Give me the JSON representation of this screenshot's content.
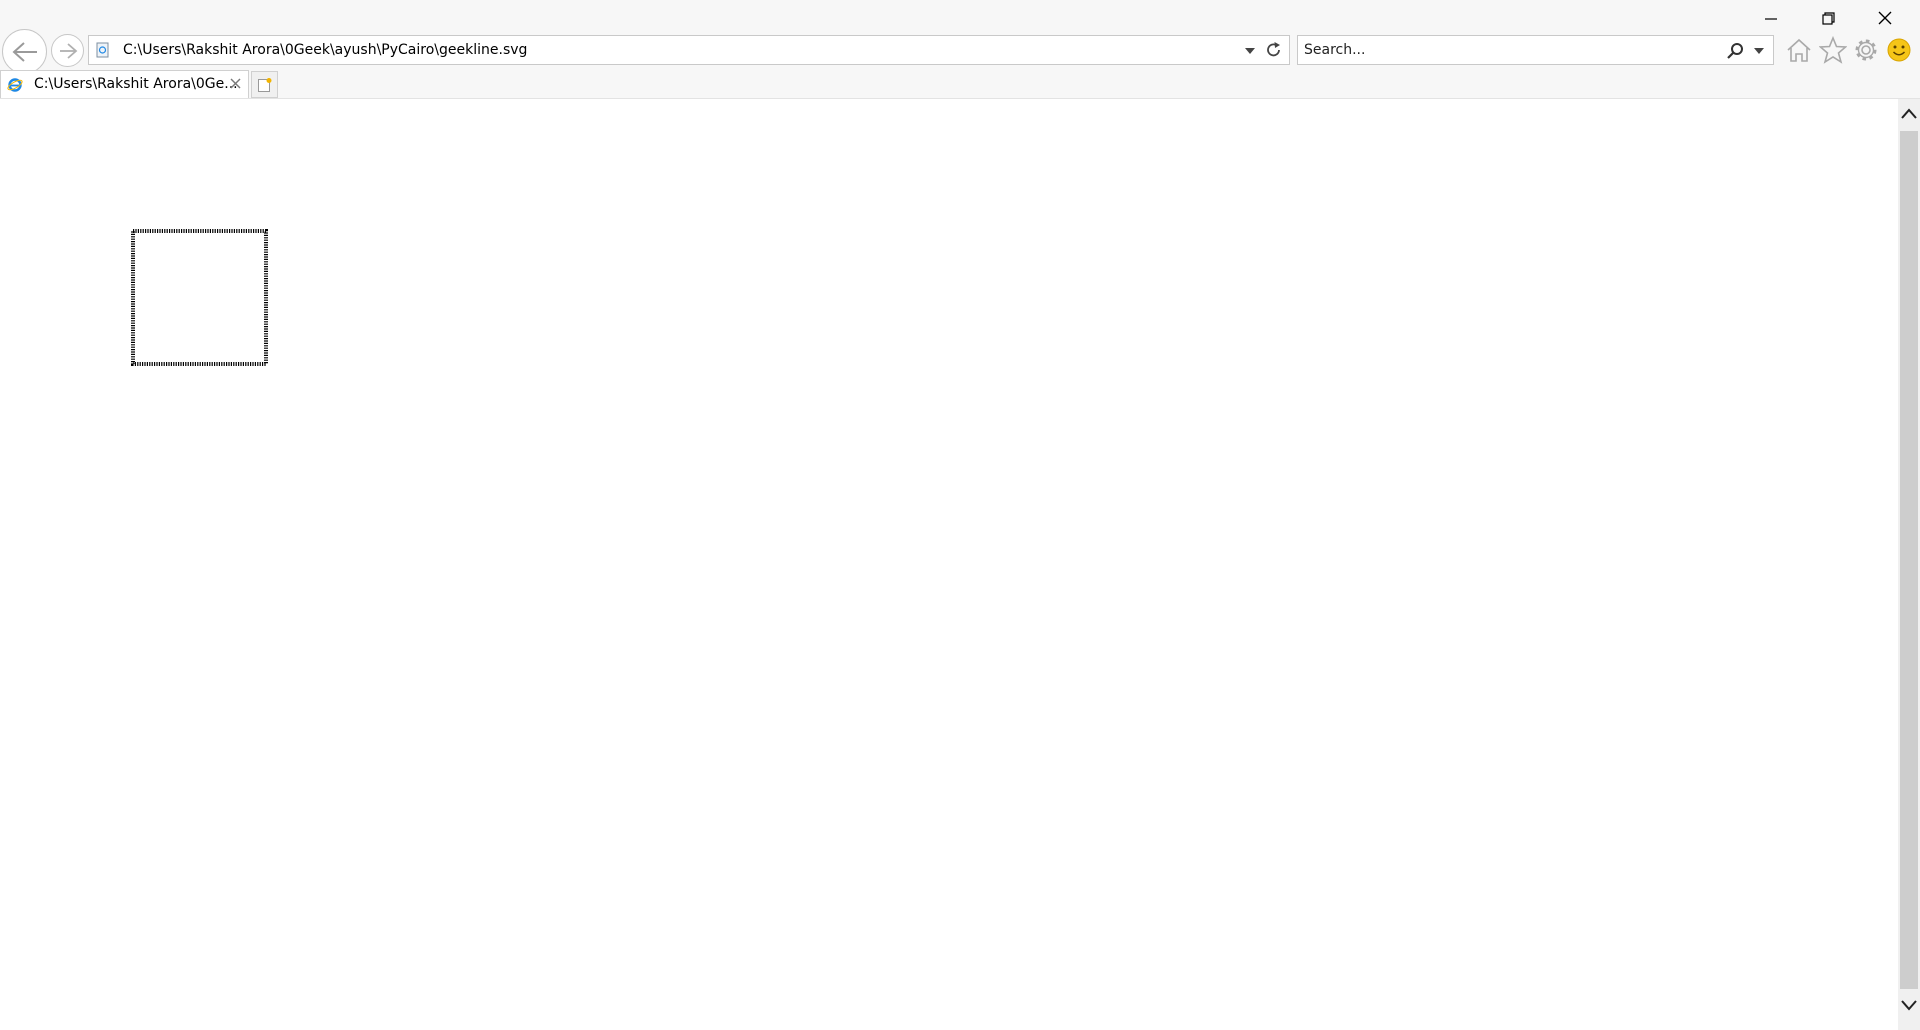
{
  "window": {
    "minimize_icon": "minimize-icon",
    "restore_icon": "restore-icon",
    "close_icon": "close-icon"
  },
  "address_bar": {
    "url": "C:\\Users\\Rakshit Arora\\0Geek\\ayush\\PyCairo\\geekline.svg"
  },
  "search": {
    "placeholder": "Search..."
  },
  "tabs": [
    {
      "title": "C:\\Users\\Rakshit Arora\\0Ge..."
    }
  ],
  "toolbar_icons": [
    "home-icon",
    "favorites-star-icon",
    "settings-gear-icon",
    "feedback-smiley-icon"
  ],
  "colors": {
    "chrome_background": "#f7f7f7",
    "scrollbar_thumb": "#cdcdcd",
    "smiley": "#f5c518",
    "ie_logo": "#1e88e5"
  }
}
